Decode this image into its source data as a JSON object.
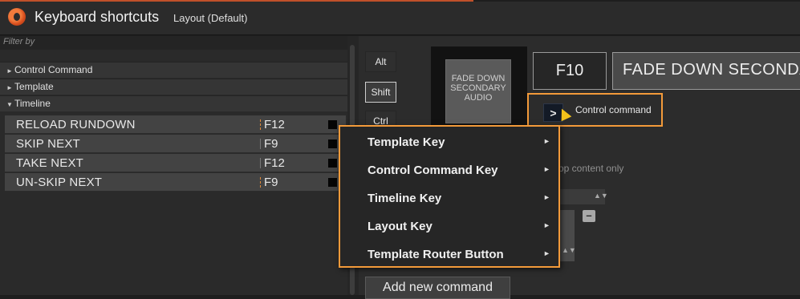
{
  "header": {
    "app_title": "Keyboard shortcuts",
    "layout_label": "Layout (Default)"
  },
  "left_panel": {
    "filter_placeholder": "Filter by",
    "groups": [
      {
        "label": "Control Command",
        "expanded": false
      },
      {
        "label": "Template",
        "expanded": false
      },
      {
        "label": "Timeline",
        "expanded": true
      }
    ],
    "commands": [
      {
        "name": "RELOAD RUNDOWN",
        "key": "F12"
      },
      {
        "name": "SKIP NEXT",
        "key": "F9"
      },
      {
        "name": "TAKE NEXT",
        "key": "F12"
      },
      {
        "name": "UN-SKIP NEXT",
        "key": "F9"
      }
    ]
  },
  "editor": {
    "modifiers": [
      "Alt",
      "Shift",
      "Ctrl"
    ],
    "preview_label": "FADE DOWN SECONDARY AUDIO",
    "key": "F10",
    "command_title": "FADE DOWN SECONDA",
    "type_button": ">",
    "type_label": "Control command",
    "drop_text": "rop content only",
    "add_command_button": "Add new command"
  },
  "context_menu": {
    "items": [
      "Template Key",
      "Control Command Key",
      "Timeline Key",
      "Layout Key",
      "Template Router Button"
    ]
  },
  "colors": {
    "accent_orange": "#f39a3a",
    "header_bg": "#2b2b2b",
    "row_bg": "#434343",
    "cursor_yellow": "#f3c21a"
  }
}
